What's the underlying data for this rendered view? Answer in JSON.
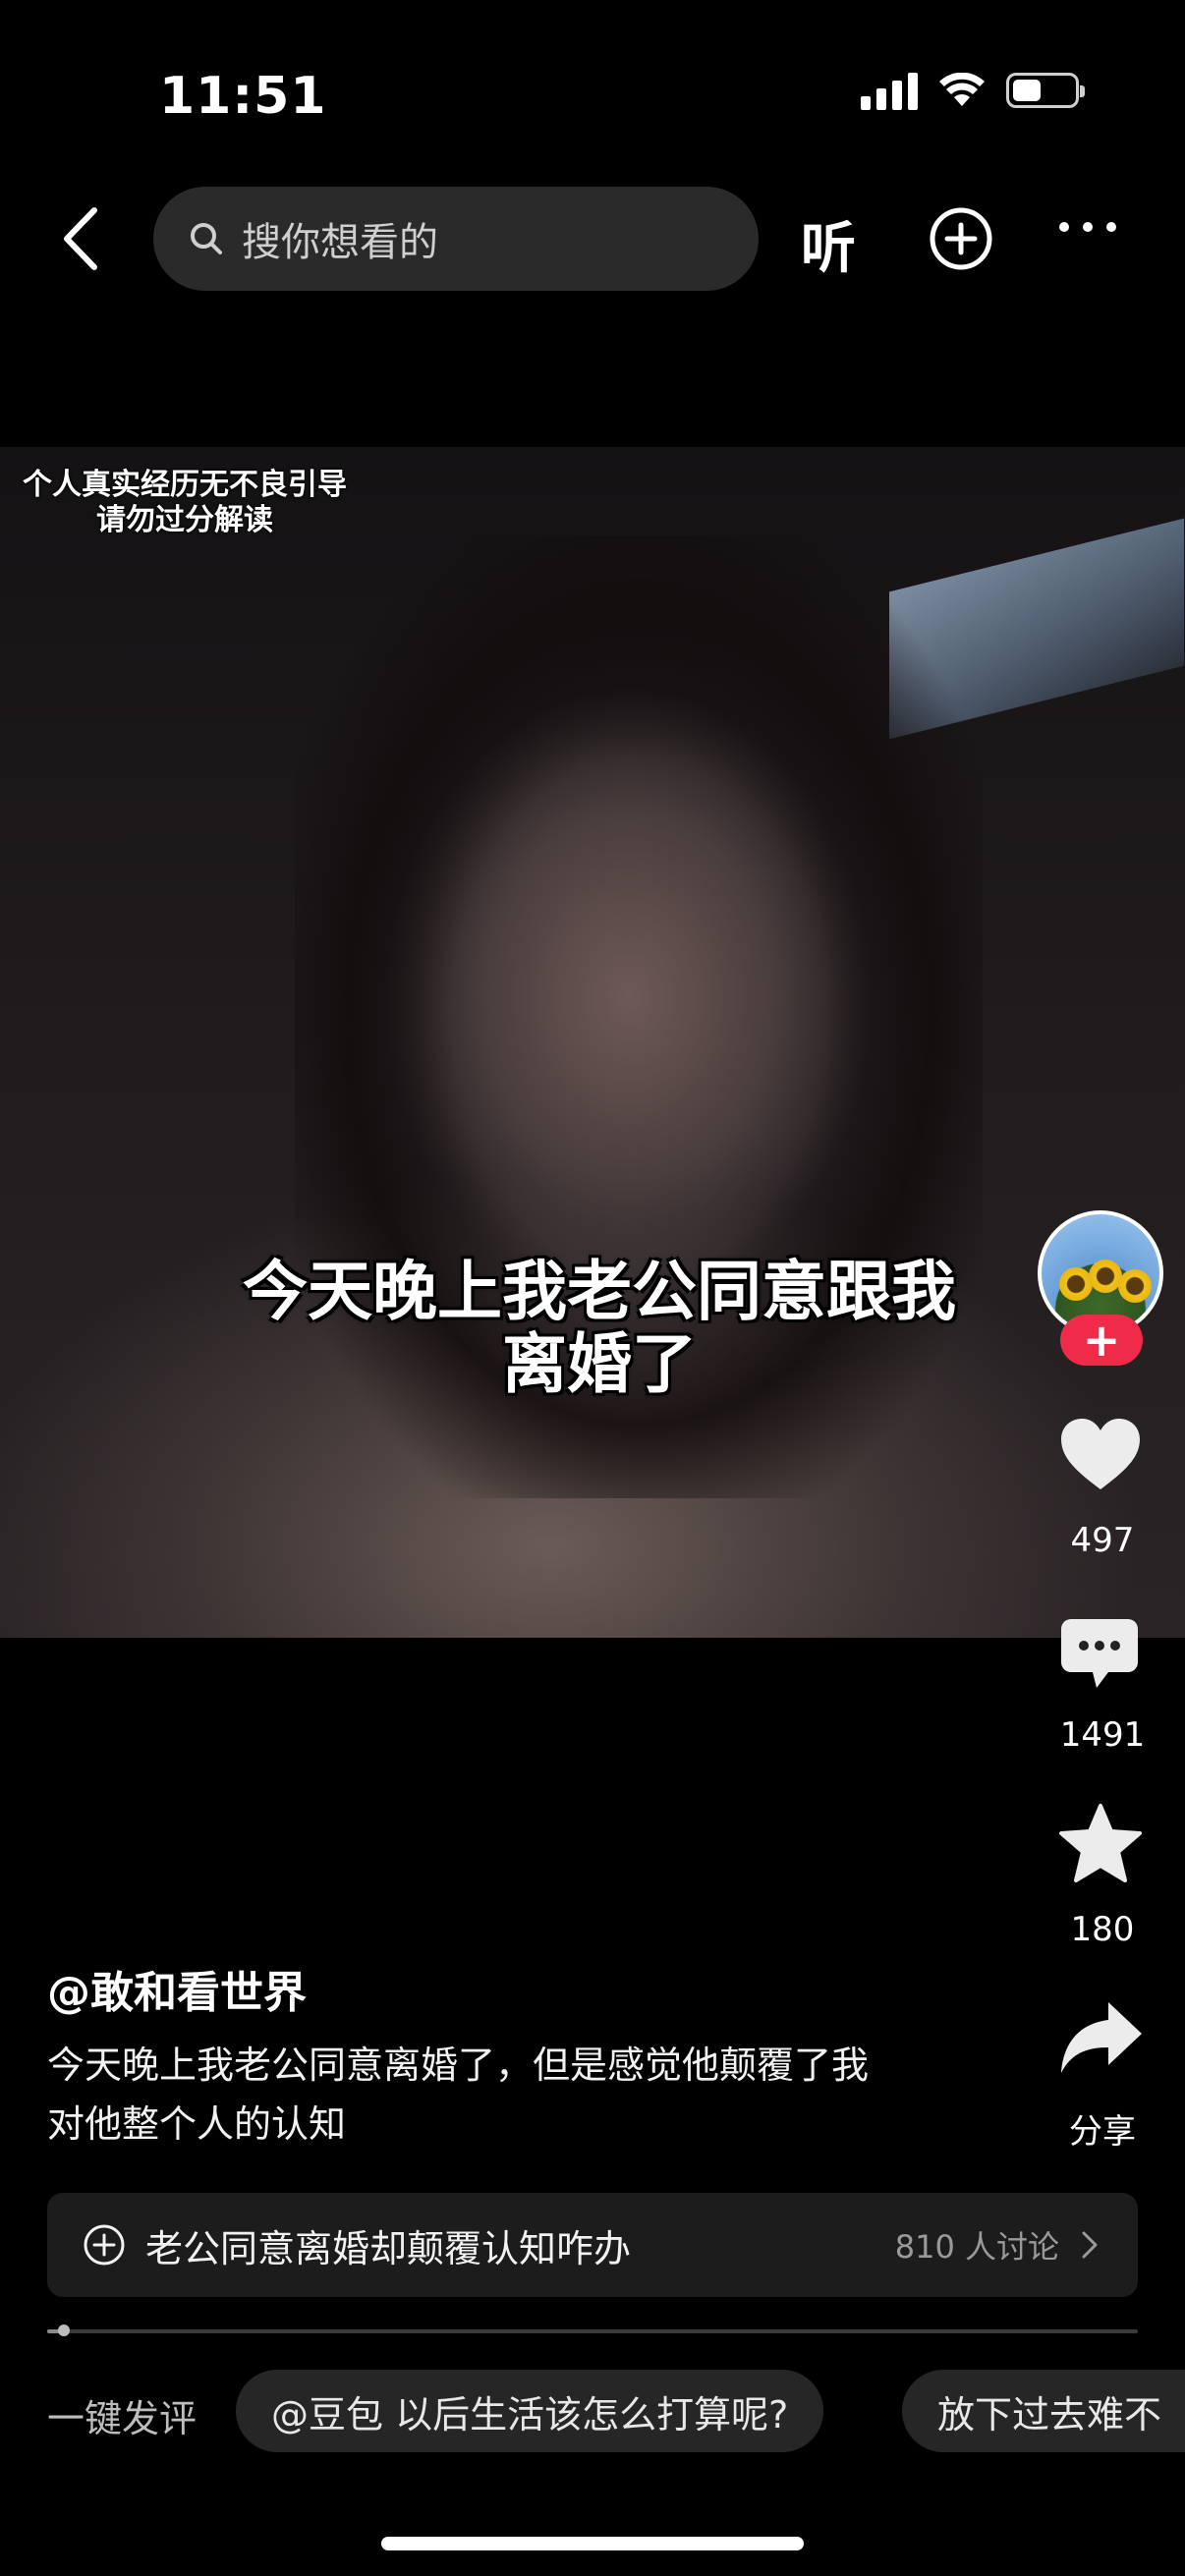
{
  "status_bar": {
    "time": "11:51",
    "battery_level": 0.45
  },
  "nav": {
    "search_placeholder": "搜你想看的",
    "listen_label": "听"
  },
  "video": {
    "disclaimer_line1": "个人真实经历无不良引导",
    "disclaimer_line2": "请勿过分解读",
    "subtitle_line1": "今天晚上我老公同意跟我",
    "subtitle_line2": "离婚了"
  },
  "actions": {
    "likes": "497",
    "comments": "1491",
    "favorites": "180",
    "share_label": "分享",
    "follow_symbol": "+"
  },
  "post": {
    "author": "@敢和看世界",
    "caption_line1": "今天晚上我老公同意离婚了，但是感觉他颠覆了我",
    "caption_line2": "对他整个人的认知"
  },
  "topic": {
    "title": "老公同意离婚却颠覆认知咋办",
    "discussion_count": "810 人讨论"
  },
  "playback": {
    "progress": 0.015
  },
  "quick_comment": {
    "label": "一键发评",
    "chips": [
      "@豆包 以后生活该怎么打算呢?",
      "放下过去难不"
    ]
  },
  "colors": {
    "background": "#000000",
    "follow_red": "#f02b4a",
    "topic_bg": "#1c1c1c",
    "chip_bg": "#262626"
  }
}
